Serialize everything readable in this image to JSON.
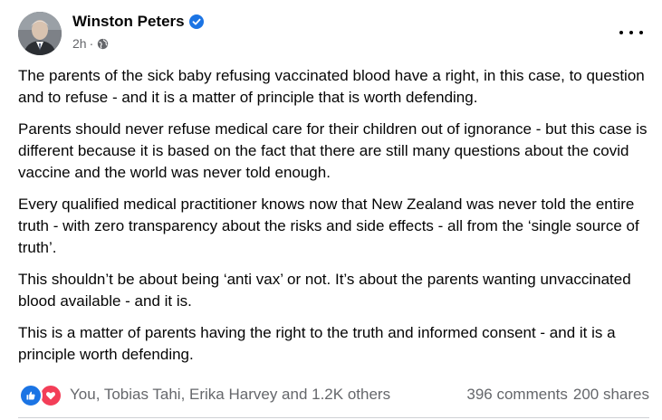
{
  "post": {
    "author": "Winston Peters",
    "time": "2h",
    "paragraphs": [
      "The parents of the sick baby refusing vaccinated blood have a right, in this case, to question and to refuse - and it is a matter of principle that is worth defending.",
      "Parents should never refuse medical care for their children out of ignorance - but this case is different because it is based on the fact that there are still many questions about the covid vaccine and the world was never told enough.",
      "Every qualified medical practitioner knows now that New Zealand was never told the entire truth - with zero transparency about the risks and side effects - all from the ‘single source of truth’.",
      "This shouldn’t be about being ‘anti vax’ or not. It’s about the parents wanting unvaccinated blood available - and it is.",
      "This is a matter of parents having the right to the truth and informed consent - and it is a principle worth defending."
    ]
  },
  "footer": {
    "reactions_text": "You, Tobias Tahi, Erika Harvey and 1.2K others",
    "comments": "396 comments",
    "shares": "200 shares"
  },
  "icons": {
    "verified": "verified-badge-icon",
    "audience": "globe-icon",
    "more": "more-options-icon",
    "like": "like-reaction-icon",
    "love": "love-reaction-icon"
  },
  "colors": {
    "verified_blue": "#1b74e4",
    "secondary_text": "#65676b",
    "love_red": "#f33e58"
  }
}
